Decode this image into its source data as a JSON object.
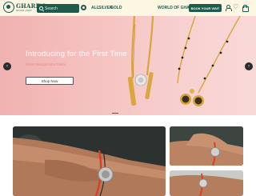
{
  "header": {
    "logo_name": "GHARE'S",
    "logo_tagline": "SINCE 1915",
    "search_placeholder": "Search",
    "nav": {
      "all": "ALL",
      "silver": "SILVER",
      "gold": "GOLD",
      "world": "WORLD OF GHARE'S"
    },
    "book_label": "BOOK YOUR VISIT",
    "colors": {
      "brand": "#1e5b4d",
      "header_bg": "#fcf6e2"
    },
    "icons": [
      "search-icon",
      "location-icon",
      "user-icon",
      "heart-icon",
      "bag-icon"
    ]
  },
  "hero": {
    "title": "Introducing for the First Time",
    "subtitle": "Silver Mangalsutra Rakhi",
    "cta_label": "Shop Now",
    "prev_arrow": "‹",
    "next_arrow": "›",
    "slide_count": 4,
    "active_slide": 1,
    "colors": {
      "bg": "#f4c1bf",
      "gold": "#d8a53c"
    }
  },
  "gallery": {
    "cards": [
      "rakhi-bracelet-wrist",
      "rakhi-bracelet-hand-top",
      "rakhi-bracelet-hand-bottom"
    ]
  }
}
